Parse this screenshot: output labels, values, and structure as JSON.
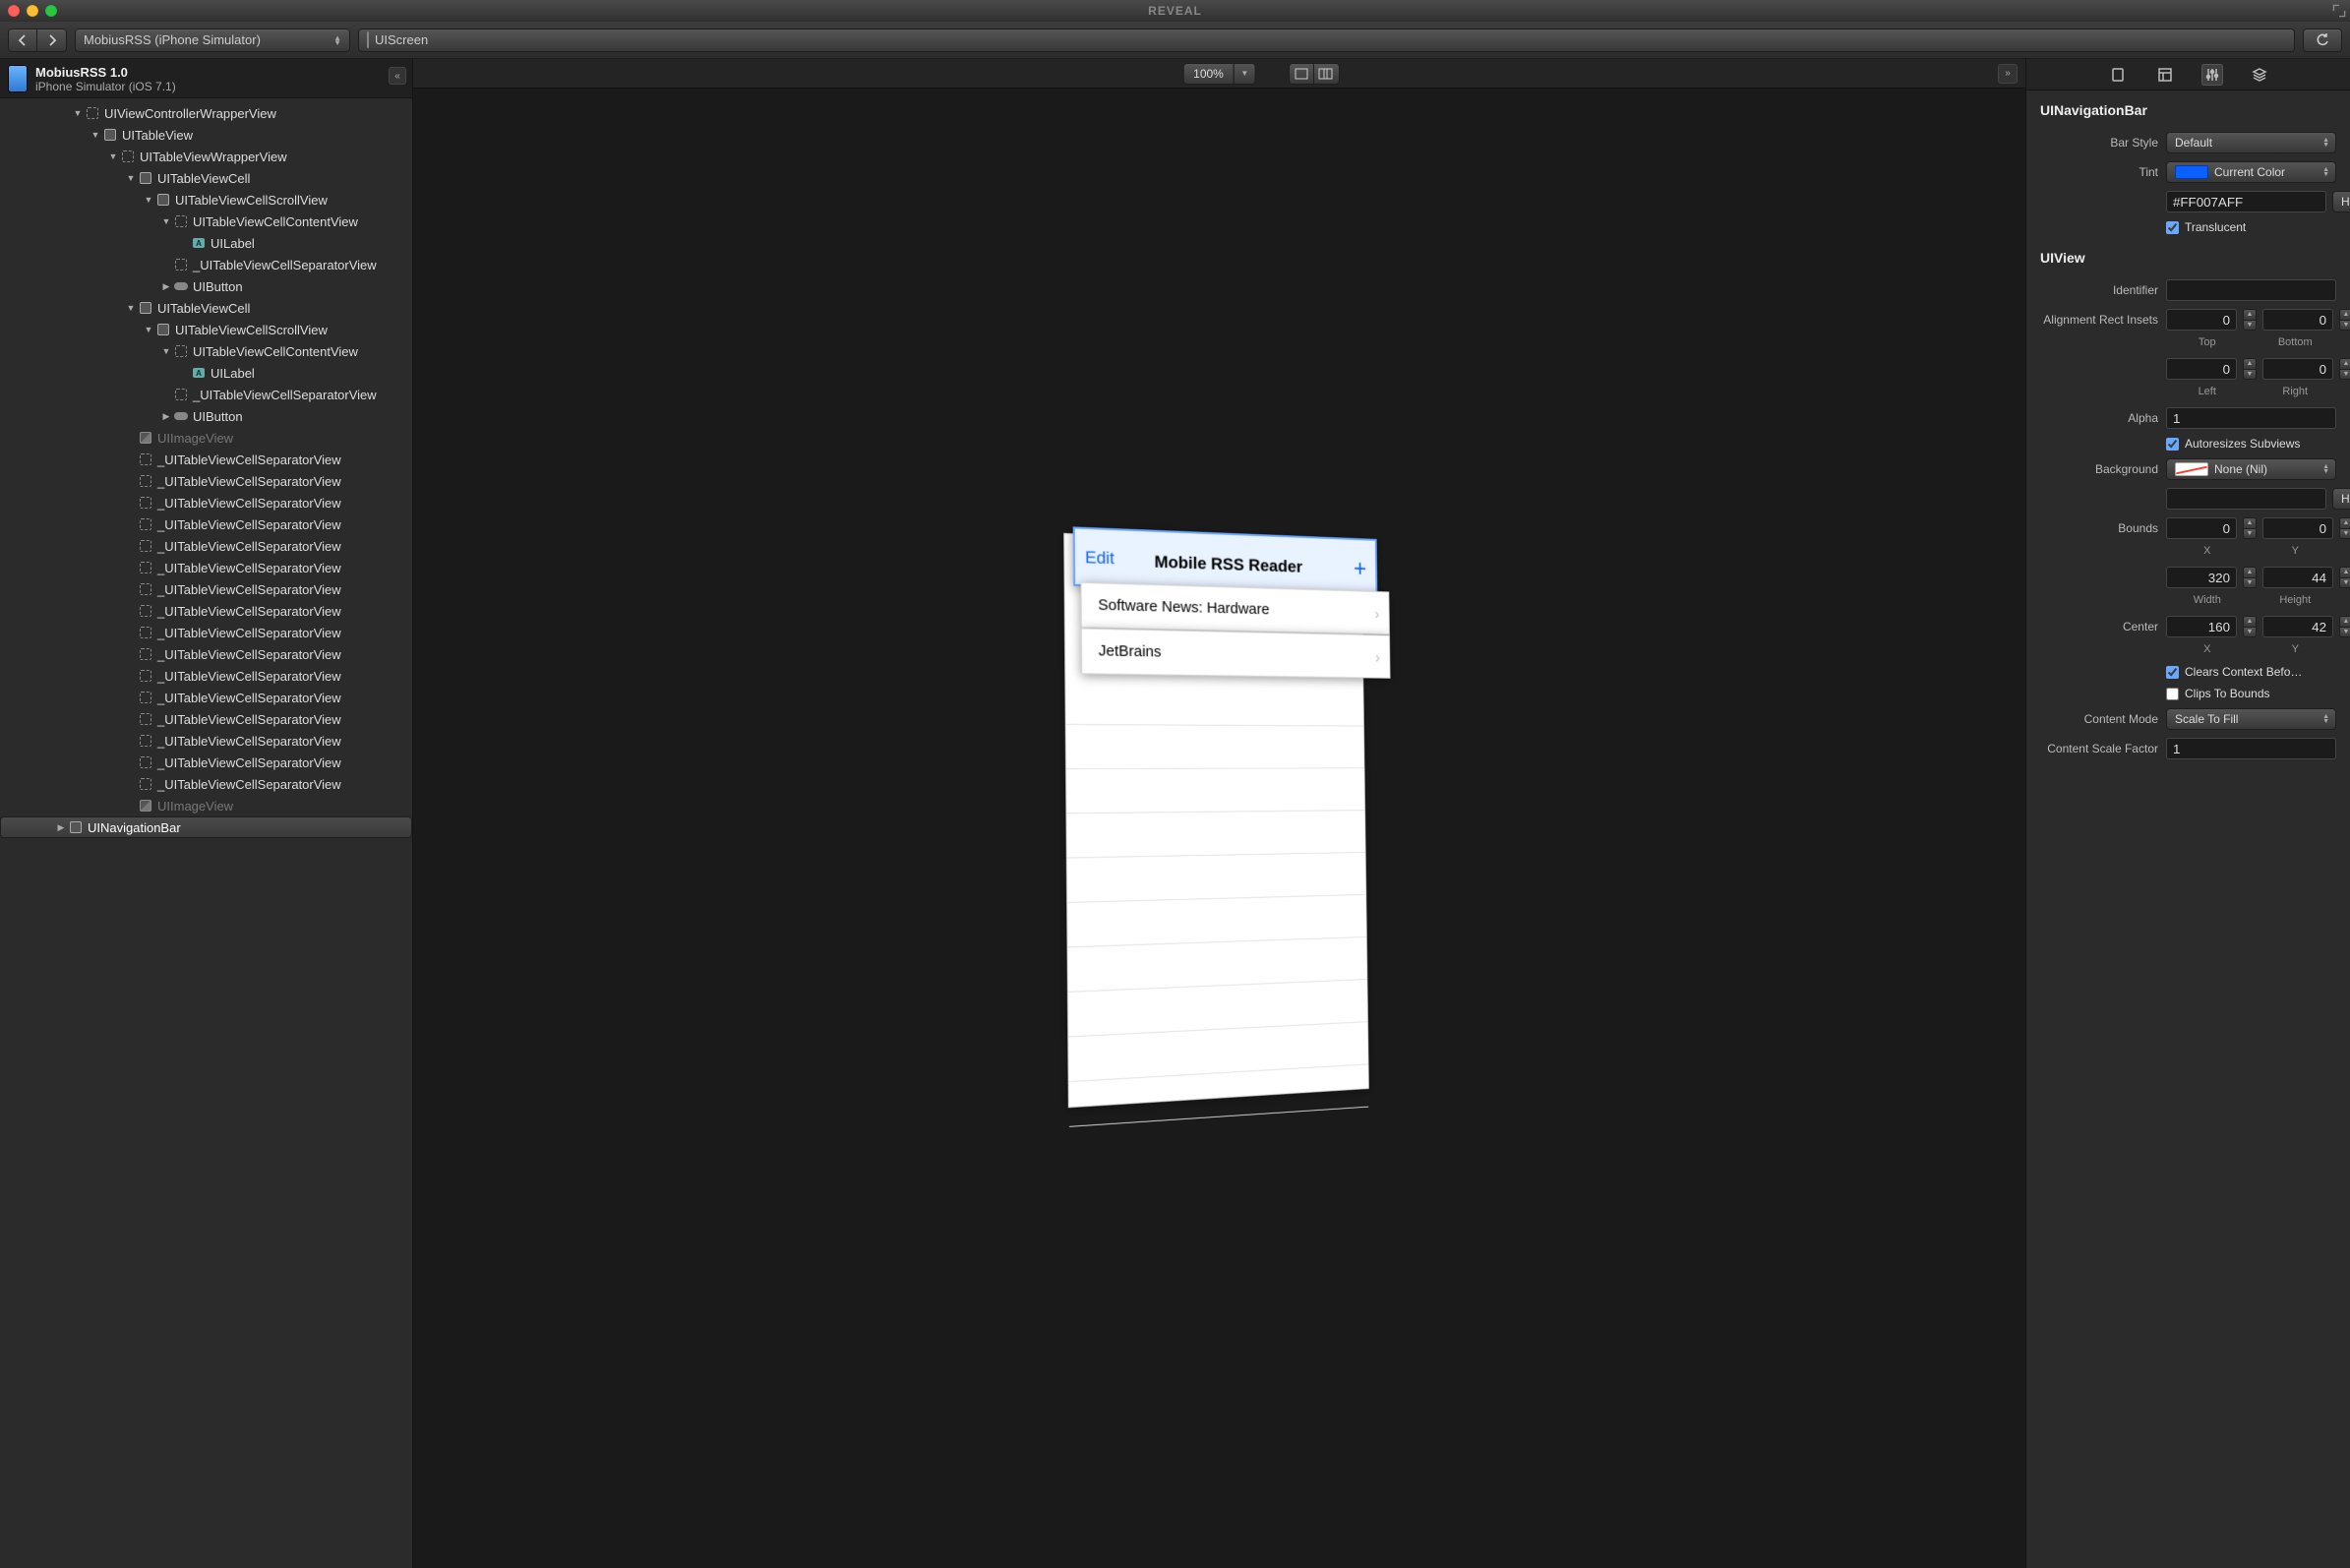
{
  "window": {
    "title": "REVEAL"
  },
  "toolbar": {
    "target": "MobiusRSS (iPhone Simulator)",
    "breadcrumb_item": "UIScreen"
  },
  "sidebar": {
    "app_name": "MobiusRSS 1.0",
    "device": "iPhone Simulator (iOS 7.1)",
    "nodes": [
      {
        "depth": 4,
        "disc": "down",
        "icon": "dashed",
        "label": "UIViewControllerWrapperView",
        "dim": false
      },
      {
        "depth": 5,
        "disc": "down",
        "icon": "solid",
        "label": "UITableView"
      },
      {
        "depth": 6,
        "disc": "down",
        "icon": "dashed",
        "label": "UITableViewWrapperView"
      },
      {
        "depth": 7,
        "disc": "down",
        "icon": "solid",
        "label": "UITableViewCell"
      },
      {
        "depth": 8,
        "disc": "down",
        "icon": "solid",
        "label": "UITableViewCellScrollView"
      },
      {
        "depth": 9,
        "disc": "down",
        "icon": "dashed",
        "label": "UITableViewCellContentView"
      },
      {
        "depth": 10,
        "disc": "",
        "icon": "label",
        "label": "UILabel"
      },
      {
        "depth": 9,
        "disc": "",
        "icon": "dashed",
        "label": "_UITableViewCellSeparatorView"
      },
      {
        "depth": 9,
        "disc": "right",
        "icon": "btn",
        "label": "UIButton"
      },
      {
        "depth": 7,
        "disc": "down",
        "icon": "solid",
        "label": "UITableViewCell"
      },
      {
        "depth": 8,
        "disc": "down",
        "icon": "solid",
        "label": "UITableViewCellScrollView"
      },
      {
        "depth": 9,
        "disc": "down",
        "icon": "dashed",
        "label": "UITableViewCellContentView"
      },
      {
        "depth": 10,
        "disc": "",
        "icon": "label",
        "label": "UILabel"
      },
      {
        "depth": 9,
        "disc": "",
        "icon": "dashed",
        "label": "_UITableViewCellSeparatorView"
      },
      {
        "depth": 9,
        "disc": "right",
        "icon": "btn",
        "label": "UIButton"
      },
      {
        "depth": 7,
        "disc": "",
        "icon": "img",
        "label": "UIImageView",
        "dim": true
      },
      {
        "depth": 7,
        "disc": "",
        "icon": "dashed",
        "label": "_UITableViewCellSeparatorView"
      },
      {
        "depth": 7,
        "disc": "",
        "icon": "dashed",
        "label": "_UITableViewCellSeparatorView"
      },
      {
        "depth": 7,
        "disc": "",
        "icon": "dashed",
        "label": "_UITableViewCellSeparatorView"
      },
      {
        "depth": 7,
        "disc": "",
        "icon": "dashed",
        "label": "_UITableViewCellSeparatorView"
      },
      {
        "depth": 7,
        "disc": "",
        "icon": "dashed",
        "label": "_UITableViewCellSeparatorView"
      },
      {
        "depth": 7,
        "disc": "",
        "icon": "dashed",
        "label": "_UITableViewCellSeparatorView"
      },
      {
        "depth": 7,
        "disc": "",
        "icon": "dashed",
        "label": "_UITableViewCellSeparatorView"
      },
      {
        "depth": 7,
        "disc": "",
        "icon": "dashed",
        "label": "_UITableViewCellSeparatorView"
      },
      {
        "depth": 7,
        "disc": "",
        "icon": "dashed",
        "label": "_UITableViewCellSeparatorView"
      },
      {
        "depth": 7,
        "disc": "",
        "icon": "dashed",
        "label": "_UITableViewCellSeparatorView"
      },
      {
        "depth": 7,
        "disc": "",
        "icon": "dashed",
        "label": "_UITableViewCellSeparatorView"
      },
      {
        "depth": 7,
        "disc": "",
        "icon": "dashed",
        "label": "_UITableViewCellSeparatorView"
      },
      {
        "depth": 7,
        "disc": "",
        "icon": "dashed",
        "label": "_UITableViewCellSeparatorView"
      },
      {
        "depth": 7,
        "disc": "",
        "icon": "dashed",
        "label": "_UITableViewCellSeparatorView"
      },
      {
        "depth": 7,
        "disc": "",
        "icon": "dashed",
        "label": "_UITableViewCellSeparatorView"
      },
      {
        "depth": 7,
        "disc": "",
        "icon": "dashed",
        "label": "_UITableViewCellSeparatorView"
      },
      {
        "depth": 7,
        "disc": "",
        "icon": "img",
        "label": "UIImageView",
        "dim": true
      },
      {
        "depth": 3,
        "disc": "right",
        "icon": "solid",
        "label": "UINavigationBar",
        "sel": true
      }
    ]
  },
  "canvas": {
    "zoom": "100%",
    "nav_edit": "Edit",
    "nav_title": "Mobile RSS Reader",
    "nav_add": "+",
    "cell1": "Software News: Hardware",
    "cell2": "JetBrains"
  },
  "inspector": {
    "section1": "UINavigationBar",
    "bar_style_label": "Bar Style",
    "bar_style_value": "Default",
    "tint_label": "Tint",
    "tint_value": "Current Color",
    "tint_hex": "#FF007AFF",
    "hex_label": "Hex",
    "translucent_label": "Translucent",
    "translucent_checked": true,
    "section2": "UIView",
    "identifier_label": "Identifier",
    "identifier_value": "",
    "insets_label": "Alignment Rect Insets",
    "insets": {
      "top": "0",
      "bottom": "0",
      "left": "0",
      "right": "0",
      "top_lbl": "Top",
      "bottom_lbl": "Bottom",
      "left_lbl": "Left",
      "right_lbl": "Right"
    },
    "alpha_label": "Alpha",
    "alpha_value": "1",
    "autoresize_label": "Autoresizes Subviews",
    "autoresize_checked": true,
    "background_label": "Background",
    "background_value": "None (Nil)",
    "bounds_label": "Bounds",
    "bounds": {
      "x": "0",
      "y": "0",
      "w": "320",
      "h": "44",
      "x_lbl": "X",
      "y_lbl": "Y",
      "w_lbl": "Width",
      "h_lbl": "Height"
    },
    "center_label": "Center",
    "center": {
      "x": "160",
      "y": "42",
      "x_lbl": "X",
      "y_lbl": "Y"
    },
    "clears_label": "Clears Context Befo…",
    "clears_checked": true,
    "clips_label": "Clips To Bounds",
    "clips_checked": false,
    "content_mode_label": "Content Mode",
    "content_mode_value": "Scale To Fill",
    "scale_factor_label": "Content Scale Factor",
    "scale_factor_value": "1"
  }
}
